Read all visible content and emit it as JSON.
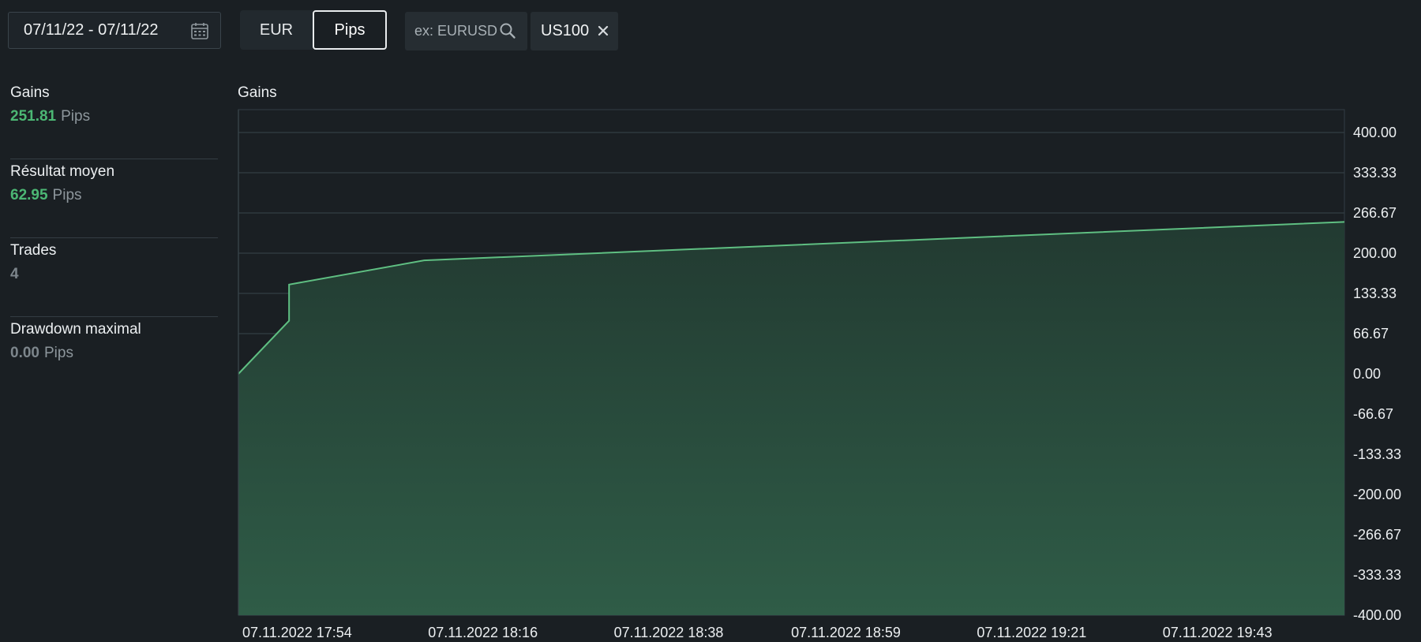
{
  "toolbar": {
    "date_range": "07/11/22 - 07/11/22",
    "unit_toggle": {
      "options": [
        "EUR",
        "Pips"
      ],
      "selected": "Pips"
    },
    "search": {
      "placeholder": "ex: EURUSD",
      "value": ""
    },
    "chip": {
      "label": "US100"
    }
  },
  "stats": [
    {
      "title": "Gains",
      "value": "251.81",
      "unit": "Pips",
      "color": "#4cb774"
    },
    {
      "title": "Résultat moyen",
      "value": "62.95",
      "unit": "Pips",
      "color": "#4cb774"
    },
    {
      "title": "Trades",
      "value": "4",
      "unit": "",
      "color": "#7d868c"
    },
    {
      "title": "Drawdown maximal",
      "value": "0.00",
      "unit": "Pips",
      "color": "#7d868c"
    }
  ],
  "chart": {
    "title": "Gains"
  },
  "chart_data": {
    "type": "area",
    "title": "Gains",
    "x": [
      "07.11.2022 17:54",
      "07.11.2022 18:00",
      "07.11.2022 18:00",
      "07.11.2022 18:16",
      "07.11.2022 20:05"
    ],
    "values": [
      0,
      88,
      148,
      188,
      251.81
    ],
    "x_tick_labels": [
      "07.11.2022 17:54",
      "07.11.2022 18:16",
      "07.11.2022 18:38",
      "07.11.2022 18:59",
      "07.11.2022 19:21",
      "07.11.2022 19:43"
    ],
    "y_tick_labels": [
      "400.00",
      "333.33",
      "266.67",
      "200.00",
      "133.33",
      "66.67",
      "0.00",
      "-66.67",
      "-133.33",
      "-200.00",
      "-266.67",
      "-333.33",
      "-400.00"
    ],
    "ylim": [
      -400,
      400
    ],
    "grid": true,
    "line_color": "#5fbf82",
    "fill_color": "#2e5c46"
  }
}
